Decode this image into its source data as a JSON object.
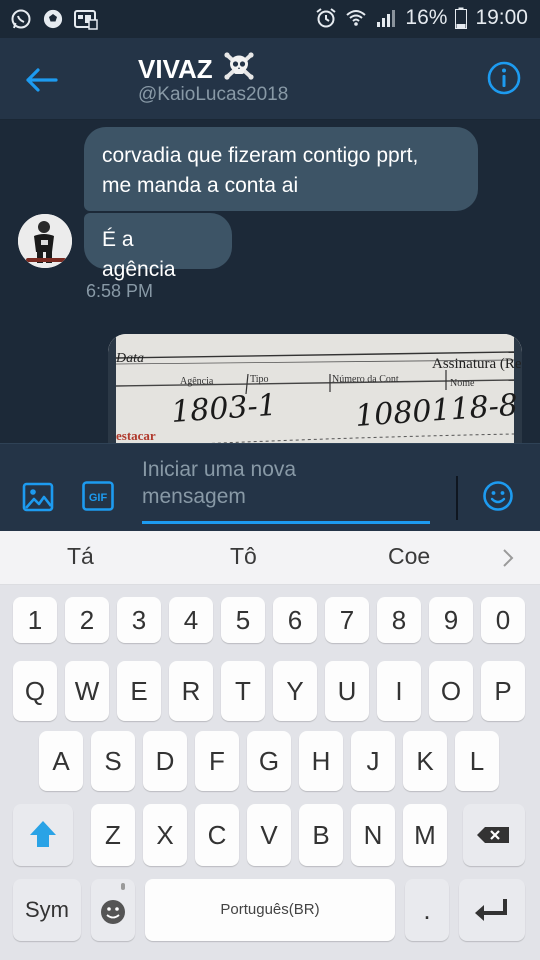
{
  "status_bar": {
    "battery": "16%",
    "time": "19:00"
  },
  "header": {
    "name": "VIVAZ",
    "handle": "@KaioLucas2018"
  },
  "conversation": {
    "messages": [
      {
        "text_line1": "corvadia que fizeram contigo pprt,",
        "text_line2": "me manda a conta ai"
      },
      {
        "text": "É a agência"
      }
    ],
    "timestamp": "6:58 PM",
    "photo_text": {
      "data": "Data",
      "agencia": "Agência",
      "tipo": "Tipo",
      "numero": "Número da Cont",
      "nome": "Nome",
      "assinatura": "Assinatura (Re",
      "destacar": "estacar",
      "hand_agency": "1803-1",
      "hand_account": "1080118-8"
    }
  },
  "composer": {
    "placeholder_line1": "Iniciar uma nova",
    "placeholder_line2": "mensagem",
    "gif_label": "GIF"
  },
  "suggestions": [
    "Tá",
    "Tô",
    "Coe"
  ],
  "keyboard": {
    "numbers": [
      "1",
      "2",
      "3",
      "4",
      "5",
      "6",
      "7",
      "8",
      "9",
      "0"
    ],
    "row1": [
      "Q",
      "W",
      "E",
      "R",
      "T",
      "Y",
      "U",
      "I",
      "O",
      "P"
    ],
    "row2": [
      "A",
      "S",
      "D",
      "F",
      "G",
      "H",
      "J",
      "K",
      "L"
    ],
    "row3": [
      "Z",
      "X",
      "C",
      "V",
      "B",
      "N",
      "M"
    ],
    "sym": "Sym",
    "space": "Português(BR)",
    "period": "."
  },
  "colors": {
    "accent": "#1d9bf0",
    "background": "#1c2938",
    "header": "#243447",
    "bubble": "#3d5466"
  }
}
